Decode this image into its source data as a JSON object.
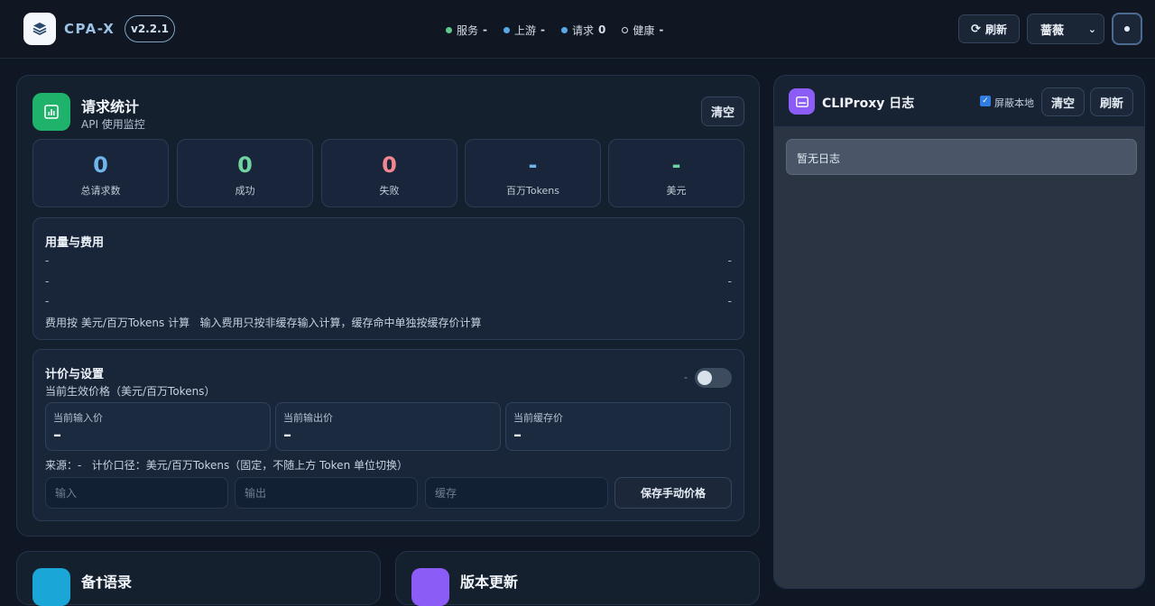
{
  "header": {
    "brand": "CPA-X",
    "version": "v2.2.1",
    "status": [
      {
        "label": "服务",
        "value": "-",
        "color": "#5fc98a"
      },
      {
        "label": "上游",
        "value": "-",
        "color": "#5aa9e6"
      },
      {
        "label": "请求",
        "value": "0",
        "color": "#5aa9e6"
      },
      {
        "label": "健康",
        "value": "-",
        "color": "#d4dde8"
      }
    ],
    "refresh_label": "刷新",
    "theme_select": "蔷薇"
  },
  "stats_card": {
    "title": "请求统计",
    "subtitle": "API 使用监控",
    "clear_label": "清空",
    "stats": [
      {
        "value": "0",
        "label": "总请求数",
        "color": "#6fb4ea"
      },
      {
        "value": "0",
        "label": "成功",
        "color": "#6fd3a0"
      },
      {
        "value": "0",
        "label": "失败",
        "color": "#f3878f"
      },
      {
        "value": "-",
        "label": "百万Tokens",
        "color": "#6fb4ea"
      },
      {
        "value": "-",
        "label": "美元",
        "color": "#6fd3a0"
      }
    ],
    "usage": {
      "title": "用量与费用",
      "rows": [
        {
          "left": "-",
          "right": "-"
        },
        {
          "left": "-",
          "right": "-"
        },
        {
          "left": "-",
          "right": "-"
        }
      ],
      "note": "费用按 美元/百万Tokens 计算   输入费用只按非缓存输入计算，缓存命中单独按缓存价计算"
    },
    "pricing": {
      "title": "计价与设置",
      "subtitle": "当前生效价格（美元/百万Tokens）",
      "toggle_label": "-",
      "toggle_on": false,
      "boxes": [
        {
          "label": "当前输入价",
          "value": "–"
        },
        {
          "label": "当前输出价",
          "value": "–"
        },
        {
          "label": "当前缓存价",
          "value": "–"
        }
      ],
      "source_note": "来源：-   计价口径：美元/百万Tokens（固定，不随上方 Token 单位切换）",
      "inputs": [
        {
          "placeholder": "输入"
        },
        {
          "placeholder": "输出"
        },
        {
          "placeholder": "缓存"
        }
      ],
      "save_label": "保存手动价格"
    }
  },
  "log_card": {
    "title": "CLIProxy 日志",
    "mask_local_label": "屏蔽本地",
    "mask_local_checked": true,
    "clear_label": "清空",
    "refresh_label": "刷新",
    "empty_text": "暂无日志"
  },
  "bottom_cards": [
    {
      "title": "备†语录"
    },
    {
      "title": "版本更新"
    }
  ],
  "colors": {
    "green_icon": "#1fb26a",
    "log_icon": "#8b5cf6",
    "cyan_icon": "#1aa6d6",
    "purple_icon": "#8b5cf6"
  }
}
